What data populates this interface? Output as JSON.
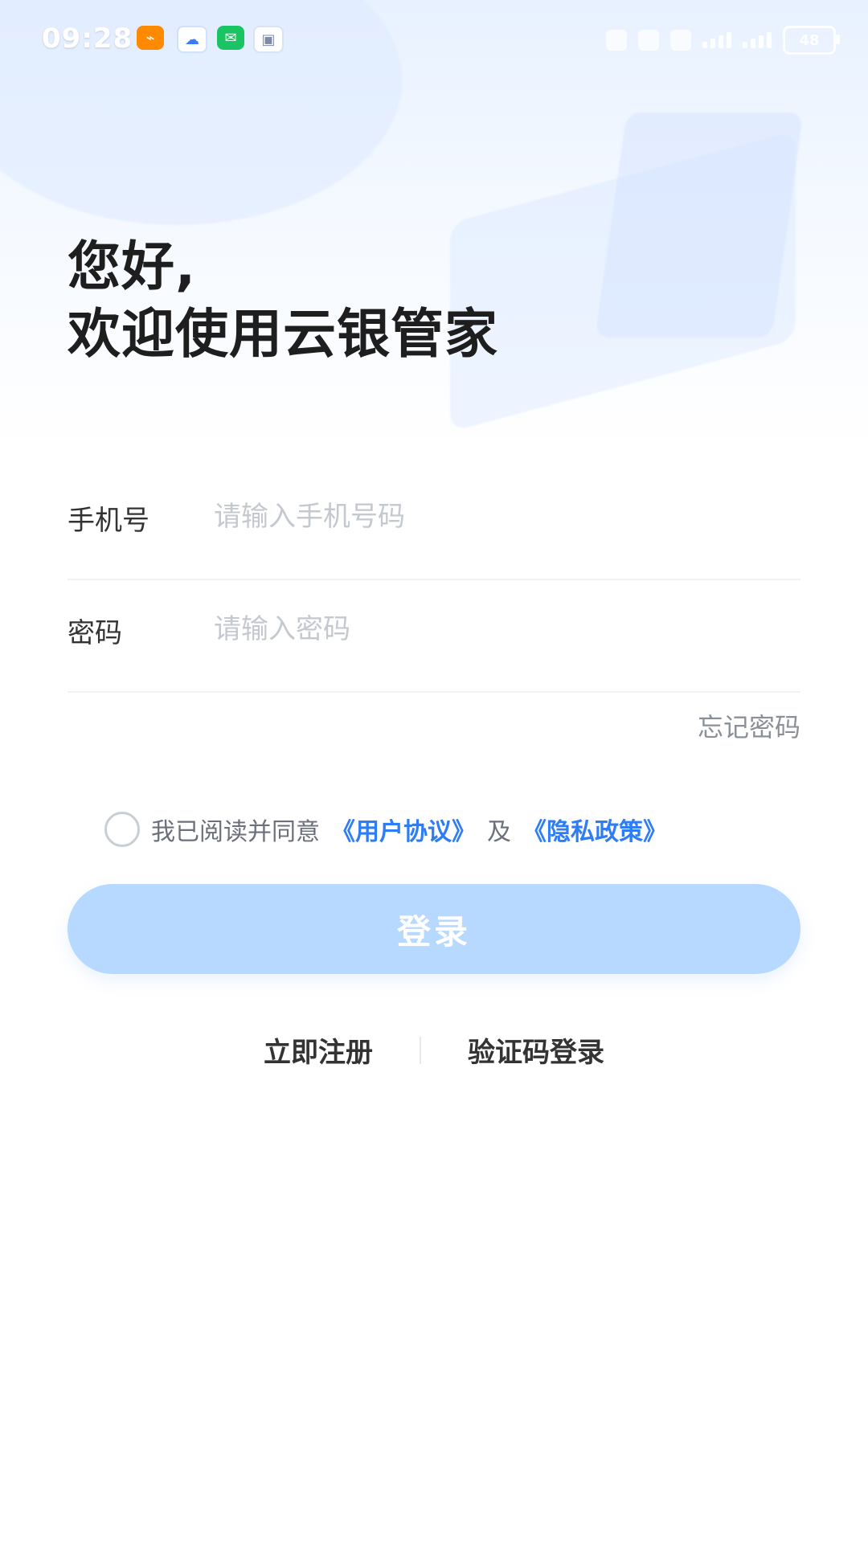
{
  "status_bar": {
    "time": "09:28",
    "battery": "48"
  },
  "greeting": {
    "line1": "您好,",
    "line2": "欢迎使用云银管家"
  },
  "form": {
    "phone_label": "手机号",
    "phone_placeholder": "请输入手机号码",
    "password_label": "密码",
    "password_placeholder": "请输入密码",
    "forgot_password": "忘记密码"
  },
  "agreement": {
    "text_prefix": "我已阅读并同意",
    "user_agreement": "《用户协议》",
    "and": "及",
    "privacy_policy": "《隐私政策》"
  },
  "buttons": {
    "login": "登录",
    "register_now": "立即注册",
    "sms_login": "验证码登录"
  },
  "colors": {
    "primary_link": "#2f7df6",
    "login_button_bg": "#b7d8ff"
  }
}
